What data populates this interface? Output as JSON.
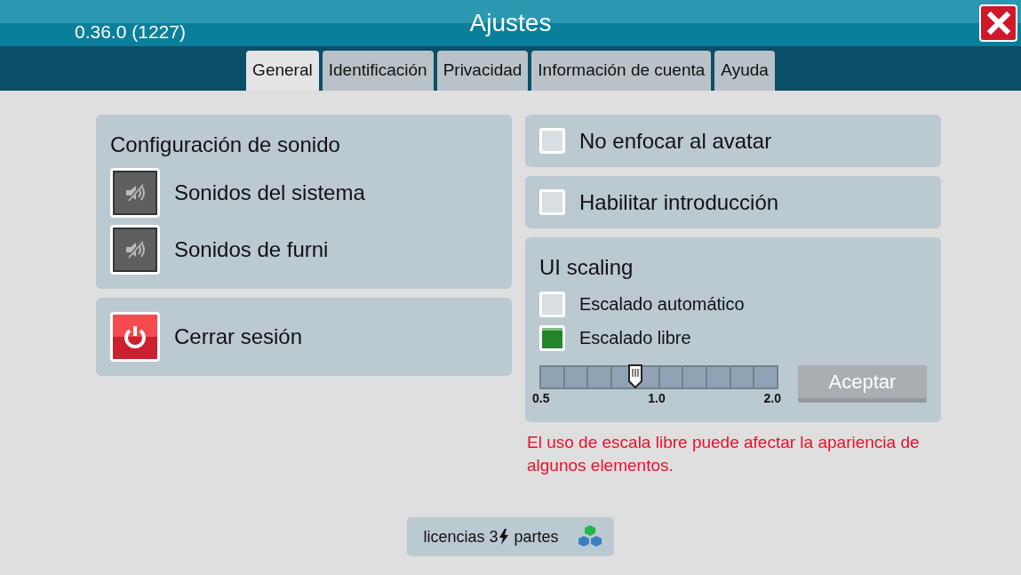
{
  "window": {
    "title": "Ajustes",
    "version": "0.36.0 (1227)"
  },
  "tabs": [
    {
      "label": "General",
      "selected": true
    },
    {
      "label": "Identificación",
      "selected": false
    },
    {
      "label": "Privacidad",
      "selected": false
    },
    {
      "label": "Información de cuenta",
      "selected": false
    },
    {
      "label": "Ayuda",
      "selected": false
    }
  ],
  "sound": {
    "title": "Configuración de sonido",
    "items": [
      {
        "label": "Sonidos del sistema",
        "muted": true
      },
      {
        "label": "Sonidos de furni",
        "muted": true
      }
    ]
  },
  "logout": {
    "label": "Cerrar sesión"
  },
  "options": [
    {
      "label": "No enfocar al avatar",
      "checked": false
    },
    {
      "label": "Habilitar introducción",
      "checked": false
    }
  ],
  "scaling": {
    "title": "UI scaling",
    "choices": [
      {
        "label": "Escalado automático",
        "selected": false
      },
      {
        "label": "Escalado libre",
        "selected": true
      }
    ],
    "slider": {
      "level": 0.4,
      "min_label": "0.5",
      "mid_label": "1.0",
      "max_label": "2.0"
    },
    "apply_button": {
      "label": "Aceptar",
      "disabled": true
    },
    "warning": "El uso de escala libre puede afectar la apariencia de algunos elementos."
  },
  "licenses": {
    "before": "licencias 3",
    "after": "partes"
  }
}
